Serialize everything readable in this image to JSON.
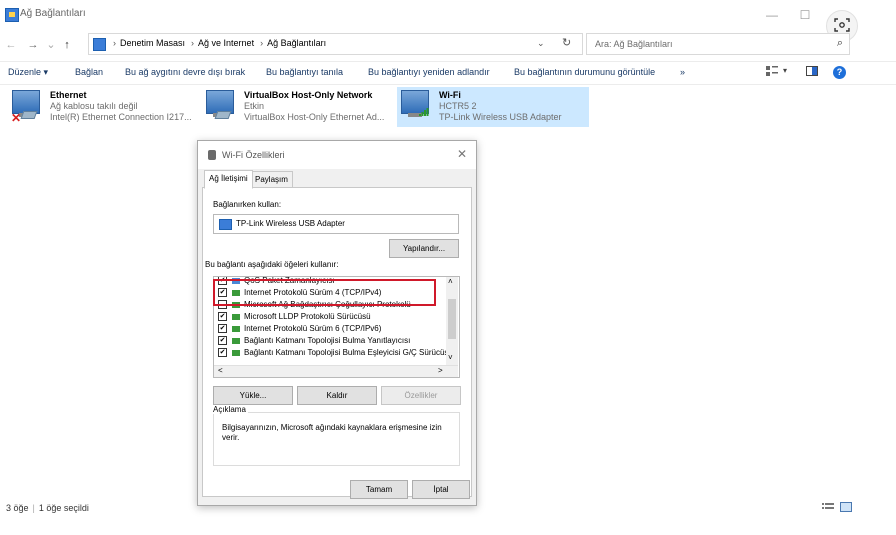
{
  "window": {
    "title": "Ağ Bağlantıları",
    "minimize": "—",
    "maximize": "☐",
    "close": "✕"
  },
  "nav": {
    "back": "←",
    "forward": "→",
    "recent": "⌄",
    "up": "↑"
  },
  "address": {
    "crumbs": [
      "Denetim Masası",
      "Ağ ve Internet",
      "Ağ Bağlantıları"
    ],
    "sep": "›",
    "lead_sep": "›",
    "dropdown": "⌄",
    "refresh": "↻"
  },
  "search": {
    "placeholder": "Ara: Ağ Bağlantıları",
    "icon": "⌕"
  },
  "commands": {
    "organize": "Düzenle ▾",
    "connect": "Bağlan",
    "disable": "Bu ağ aygıtını devre dışı bırak",
    "diagnose": "Bu bağlantıyı tanıla",
    "rename": "Bu bağlantıyı yeniden adlandır",
    "status": "Bu bağlantının durumunu görüntüle",
    "more": "»",
    "view_dd": "▾",
    "help": "?"
  },
  "adapters": [
    {
      "name": "Ethernet",
      "status": "Ağ kablosu takılı değil",
      "device": "Intel(R) Ethernet Connection I217...",
      "error_mark": "✕"
    },
    {
      "name": "VirtualBox Host-Only Network",
      "status": "Etkin",
      "device": "VirtualBox Host-Only Ethernet Ad..."
    },
    {
      "name": "Wi-Fi",
      "status": "HCTR5 2",
      "device": "TP-Link Wireless USB Adapter"
    }
  ],
  "dialog": {
    "title": "Wi-Fi Özellikleri",
    "close": "✕",
    "tabs": [
      "Ağ İletişimi",
      "Paylaşım"
    ],
    "connect_using_label": "Bağlanırken kullan:",
    "adapter_name": "TP-Link Wireless USB Adapter",
    "configure_btn": "Yapılandır...",
    "items_label": "Bu bağlantı aşağıdaki öğeleri kullanır:",
    "items": [
      {
        "label": "QoS Paket Zamanlayıcısı",
        "checked": "✔"
      },
      {
        "label": "Internet Protokolü Sürüm 4 (TCP/IPv4)",
        "checked": "✔"
      },
      {
        "label": "Microsoft Ağ Bağdaştırıcı Çoğullayıcı Protokolü",
        "checked": ""
      },
      {
        "label": "Microsoft LLDP Protokolü Sürücüsü",
        "checked": "✔"
      },
      {
        "label": "Internet Protokolü Sürüm 6 (TCP/IPv6)",
        "checked": "✔"
      },
      {
        "label": "Bağlantı Katmanı Topolojisi Bulma Yanıtlayıcısı",
        "checked": "✔"
      },
      {
        "label": "Bağlantı Katmanı Topolojisi Bulma Eşleyicisi G/Ç Sürücüsü",
        "checked": "✔"
      }
    ],
    "scroll_up": "˄",
    "scroll_down": "˅",
    "scroll_left": "<",
    "scroll_right": ">",
    "install_btn": "Yükle...",
    "uninstall_btn": "Kaldır",
    "properties_btn": "Özellikler",
    "description_label": "Açıklama",
    "description": "Bilgisayarınızın, Microsoft ağındaki kaynaklara erişmesine izin verir.",
    "ok_btn": "Tamam",
    "cancel_btn": "İptal"
  },
  "status_bar": {
    "items": "3 öğe",
    "selected": "1 öğe seçildi"
  },
  "colors": {
    "accent": "#1e6fd9",
    "selection": "#cce8ff",
    "highlight_box": "#d0192a"
  }
}
